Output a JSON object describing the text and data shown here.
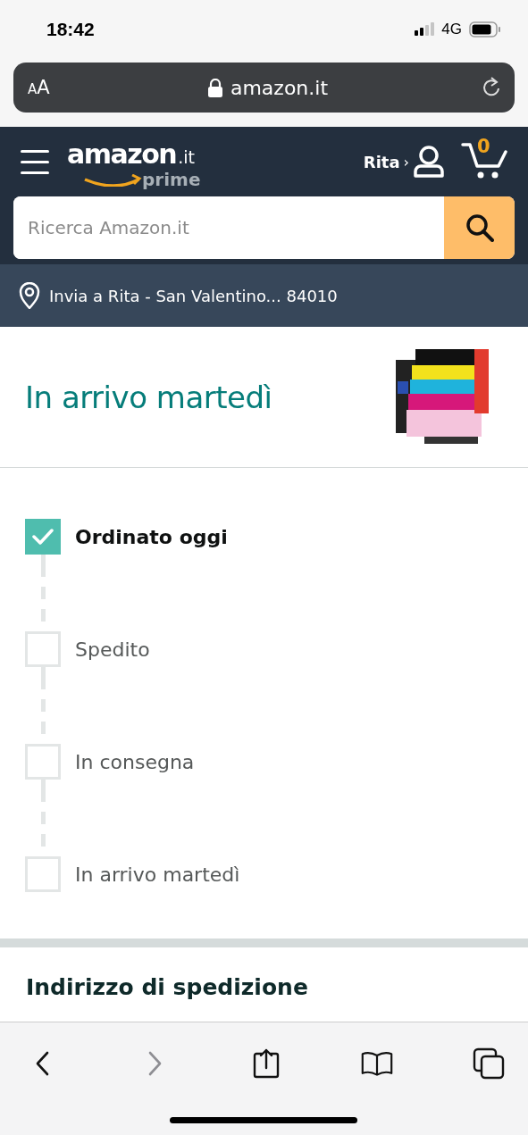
{
  "status_bar": {
    "time": "18:42",
    "network": "4G"
  },
  "address_bar": {
    "text_size_button": "AA",
    "url": "amazon.it"
  },
  "header": {
    "logo_text": "amazon",
    "logo_domain": ".it",
    "logo_sub": "prime",
    "account": "Rita",
    "account_chevron": "›",
    "cart_count": "0"
  },
  "search": {
    "placeholder": "Ricerca Amazon.it"
  },
  "location": {
    "text": "Invia a Rita - San Valentino... 84010"
  },
  "delivery": {
    "title": "In arrivo martedì"
  },
  "steps": [
    {
      "label": "Ordinato oggi",
      "checked": true
    },
    {
      "label": "Spedito",
      "checked": false
    },
    {
      "label": "In consegna",
      "checked": false
    },
    {
      "label": "In arrivo martedì",
      "checked": false
    }
  ],
  "shipping": {
    "title": "Indirizzo di spedizione"
  },
  "toolbar": [
    {
      "kind": "back",
      "disabled": false
    },
    {
      "kind": "forward",
      "disabled": true
    },
    {
      "kind": "share",
      "disabled": false
    },
    {
      "kind": "bookmarks",
      "disabled": false
    },
    {
      "kind": "tabs",
      "disabled": false
    }
  ]
}
